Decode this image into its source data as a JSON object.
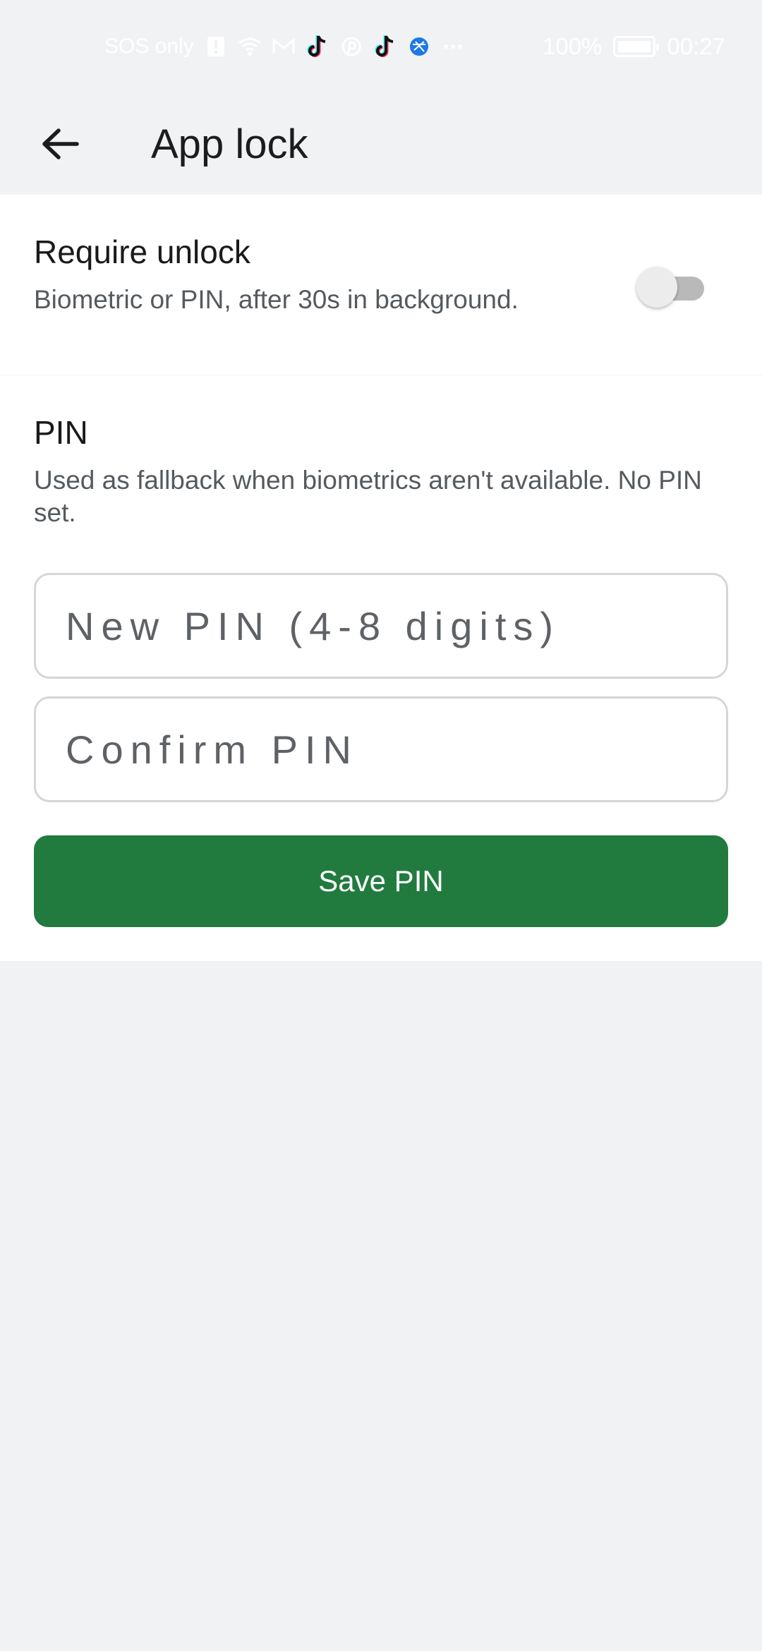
{
  "status_bar": {
    "carrier": "SOS only",
    "battery": "100%",
    "time": "00:27",
    "icons": [
      "alert-icon",
      "wifi-icon",
      "mail-icon",
      "tiktok-icon",
      "pinterest-icon",
      "tiktok-icon",
      "browser-icon",
      "more-icon"
    ]
  },
  "toolbar": {
    "title": "App lock",
    "back_icon": "arrow-left-icon"
  },
  "require_unlock": {
    "title": "Require unlock",
    "subtitle": "Biometric or PIN, after 30s in background.",
    "enabled": false
  },
  "pin": {
    "title": "PIN",
    "subtitle": "Used as fallback when biometrics aren't available. No PIN set.",
    "new_pin": {
      "value": "",
      "placeholder": "New PIN (4-8 digits)"
    },
    "confirm_pin": {
      "value": "",
      "placeholder": "Confirm PIN"
    },
    "save_label": "Save PIN"
  },
  "colors": {
    "background": "#f1f2f4",
    "card": "#ffffff",
    "accent": "#217b3e",
    "toggle_off": "#b9b9b9"
  }
}
